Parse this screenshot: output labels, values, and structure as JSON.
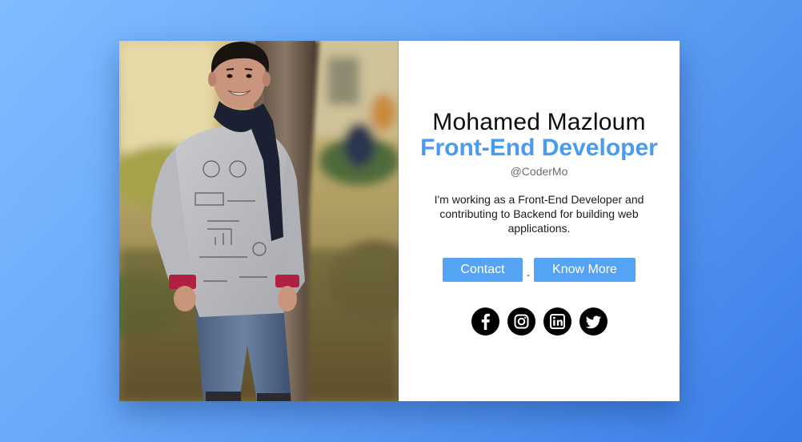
{
  "profile": {
    "name": "Mohamed Mazloum",
    "role": "Front-End Developer",
    "handle": "@CoderMo",
    "bio": "I'm working as a Front-End Developer and contributing to Backend for building web applications."
  },
  "actions": {
    "contact_label": "Contact",
    "separator": "-",
    "more_label": "Know More"
  },
  "socials": [
    {
      "icon": "facebook-icon"
    },
    {
      "icon": "instagram-icon"
    },
    {
      "icon": "linkedin-icon"
    },
    {
      "icon": "twitter-icon"
    }
  ],
  "colors": {
    "accent": "#4a9af0",
    "button": "#55a3f5",
    "card": "#ffffff"
  }
}
